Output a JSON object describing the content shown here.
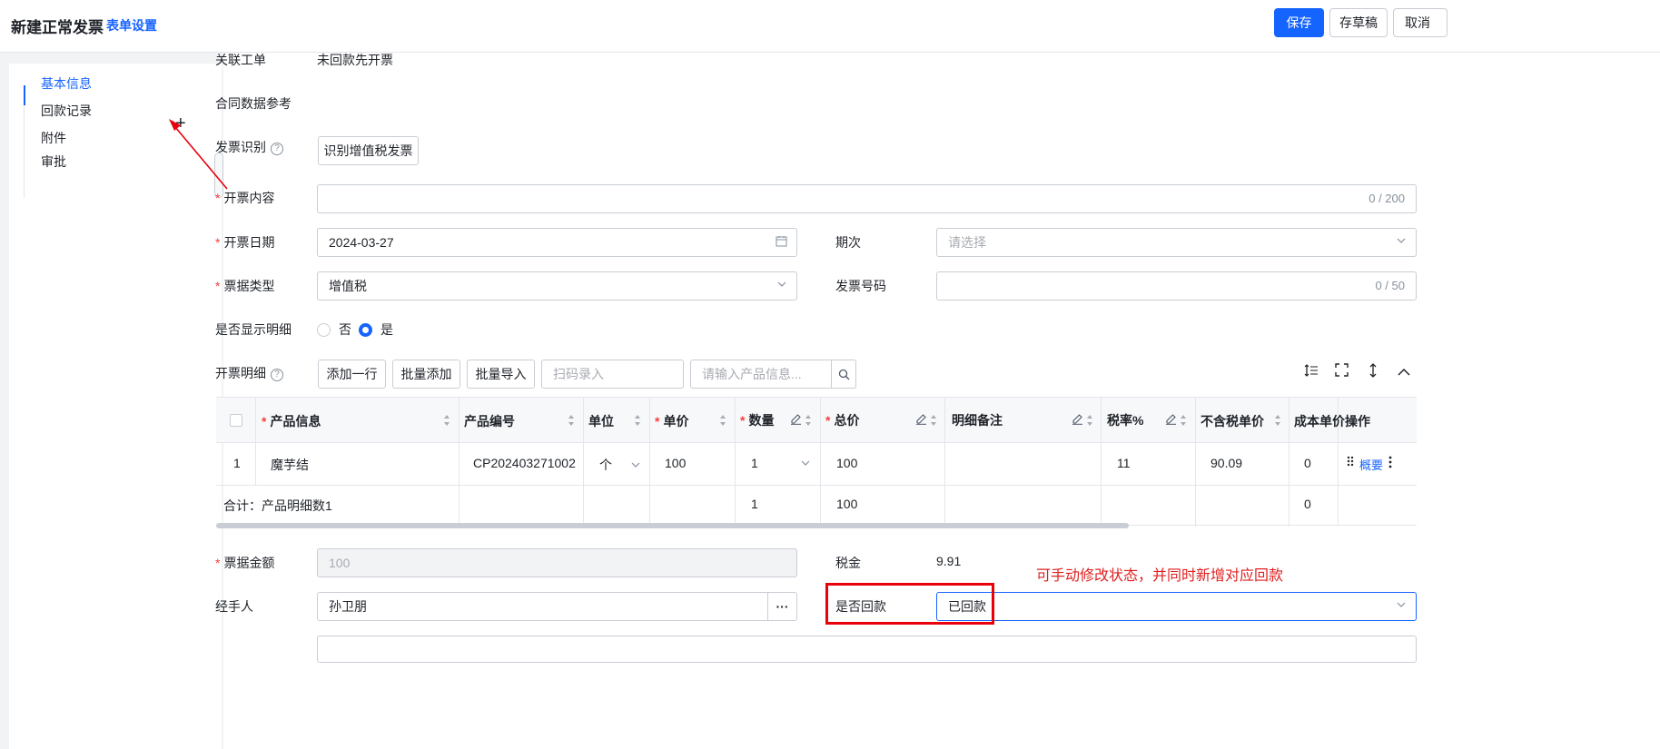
{
  "header": {
    "title": "新建正常发票",
    "form_settings": "表单设置",
    "save": "保存",
    "draft": "存草稿",
    "cancel": "取消"
  },
  "sidenav": {
    "items": [
      {
        "label": "基本信息",
        "active": true
      },
      {
        "label": "回款记录",
        "active": false
      },
      {
        "label": "附件",
        "active": false
      },
      {
        "label": "审批",
        "active": false
      }
    ],
    "add_icon": "plus-icon"
  },
  "form": {
    "related_order": {
      "label": "关联工单",
      "value": "未回款先开票"
    },
    "contract_ref": {
      "label": "合同数据参考"
    },
    "invoice_recognize": {
      "label": "发票识别",
      "button": "识别增值税发票"
    },
    "content": {
      "label": "开票内容",
      "value": "",
      "count": "0 / 200"
    },
    "date": {
      "label": "开票日期",
      "value": "2024-03-27"
    },
    "period": {
      "label": "期次",
      "placeholder": "请选择"
    },
    "type": {
      "label": "票据类型",
      "value": "增值税"
    },
    "invoice_no": {
      "label": "发票号码",
      "count": "0 / 50"
    },
    "show_detail": {
      "label": "是否显示明细",
      "options": [
        "否",
        "是"
      ],
      "selected": "是"
    },
    "detail": {
      "label": "开票明细",
      "add_row": "添加一行",
      "batch_add": "批量添加",
      "batch_import": "批量导入",
      "scan_placeholder": "扫码录入",
      "search_placeholder": "请输入产品信息..."
    },
    "amount": {
      "label": "票据金额",
      "value": "100"
    },
    "tax": {
      "label": "税金",
      "value": "9.91"
    },
    "handler": {
      "label": "经手人",
      "value": "孙卫朋",
      "more": "···"
    },
    "is_paid": {
      "label": "是否回款",
      "value": "已回款"
    }
  },
  "table": {
    "headers": [
      "产品信息",
      "产品编号",
      "单位",
      "单价",
      "数量",
      "总价",
      "明细备注",
      "税率%",
      "不含税单价",
      "成本单价",
      "操作"
    ],
    "rows": [
      {
        "index": "1",
        "product": "魔芋结",
        "code": "CP202403271002",
        "unit": "个",
        "price": "100",
        "qty": "1",
        "total": "100",
        "remark": "",
        "tax_rate": "11",
        "pre_tax_price": "90.09",
        "cost": "0",
        "action": "概要"
      }
    ],
    "summary": {
      "label": "合计：产品明细数1",
      "qty": "1",
      "total": "100",
      "cost": "0"
    }
  },
  "annotation": {
    "text": "可手动修改状态，并同时新增对应回款",
    "color": "#e02020"
  },
  "colors": {
    "accent": "#1664ff",
    "required": "#f53f3f"
  }
}
